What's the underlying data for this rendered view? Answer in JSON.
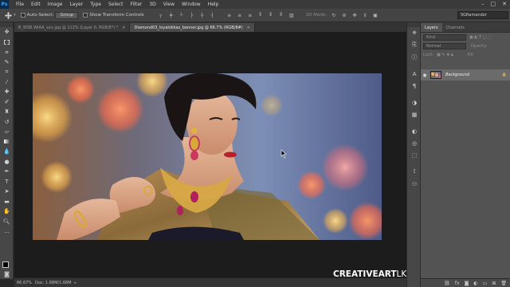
{
  "app": {
    "logo": "Ps"
  },
  "menu": [
    "File",
    "Edit",
    "Image",
    "Layer",
    "Type",
    "Select",
    "Filter",
    "3D",
    "View",
    "Window",
    "Help"
  ],
  "window_controls": [
    "–",
    "□",
    "✕"
  ],
  "options": {
    "auto_select_label": "Auto-Select:",
    "auto_select_value": "Group",
    "transform_label": "Show Transform Controls",
    "mode_3d_label": "3D Mode:",
    "workspace": "SGRamandor"
  },
  "tools": [
    "move-icon",
    "marquee-icon",
    "lasso-icon",
    "quick-select-icon",
    "crop-icon",
    "eyedropper-icon",
    "healing-icon",
    "brush-icon",
    "clone-stamp-icon",
    "history-brush-icon",
    "eraser-icon",
    "gradient-icon",
    "blur-icon",
    "dodge-icon",
    "pen-icon",
    "type-icon",
    "path-select-icon",
    "rectangle-icon",
    "hand-icon",
    "zoom-icon",
    "more-icon"
  ],
  "tabs": [
    {
      "label": "B_WSB.WIAA_xxx.jpg @ 112% (Layer 0, RGB/8*) *",
      "close": "×"
    },
    {
      "label": "Diamond03_loyalokkas_banner.jpg @ 66.7% (RGB/8#)",
      "close": "×"
    }
  ],
  "status": {
    "zoom": "66.67%",
    "doc": "Doc: 1.68M/1.68M",
    "arrow": "▸"
  },
  "watermark": {
    "main": "CREATIVEART",
    "suffix": "LK"
  },
  "layers_panel": {
    "tabs": [
      "Layers",
      "Channels"
    ],
    "kind_label": "Kind",
    "blend_mode": "Normal",
    "opacity_label": "Opacity:",
    "lock_label": "Lock:",
    "fill_label": "Fill:",
    "layer_name": "Background",
    "lock_icon": "🔒"
  },
  "colors": {
    "ps_blue": "#31a8ff",
    "panel_bg": "#535353",
    "canvas_bg": "#1c1c1c"
  }
}
